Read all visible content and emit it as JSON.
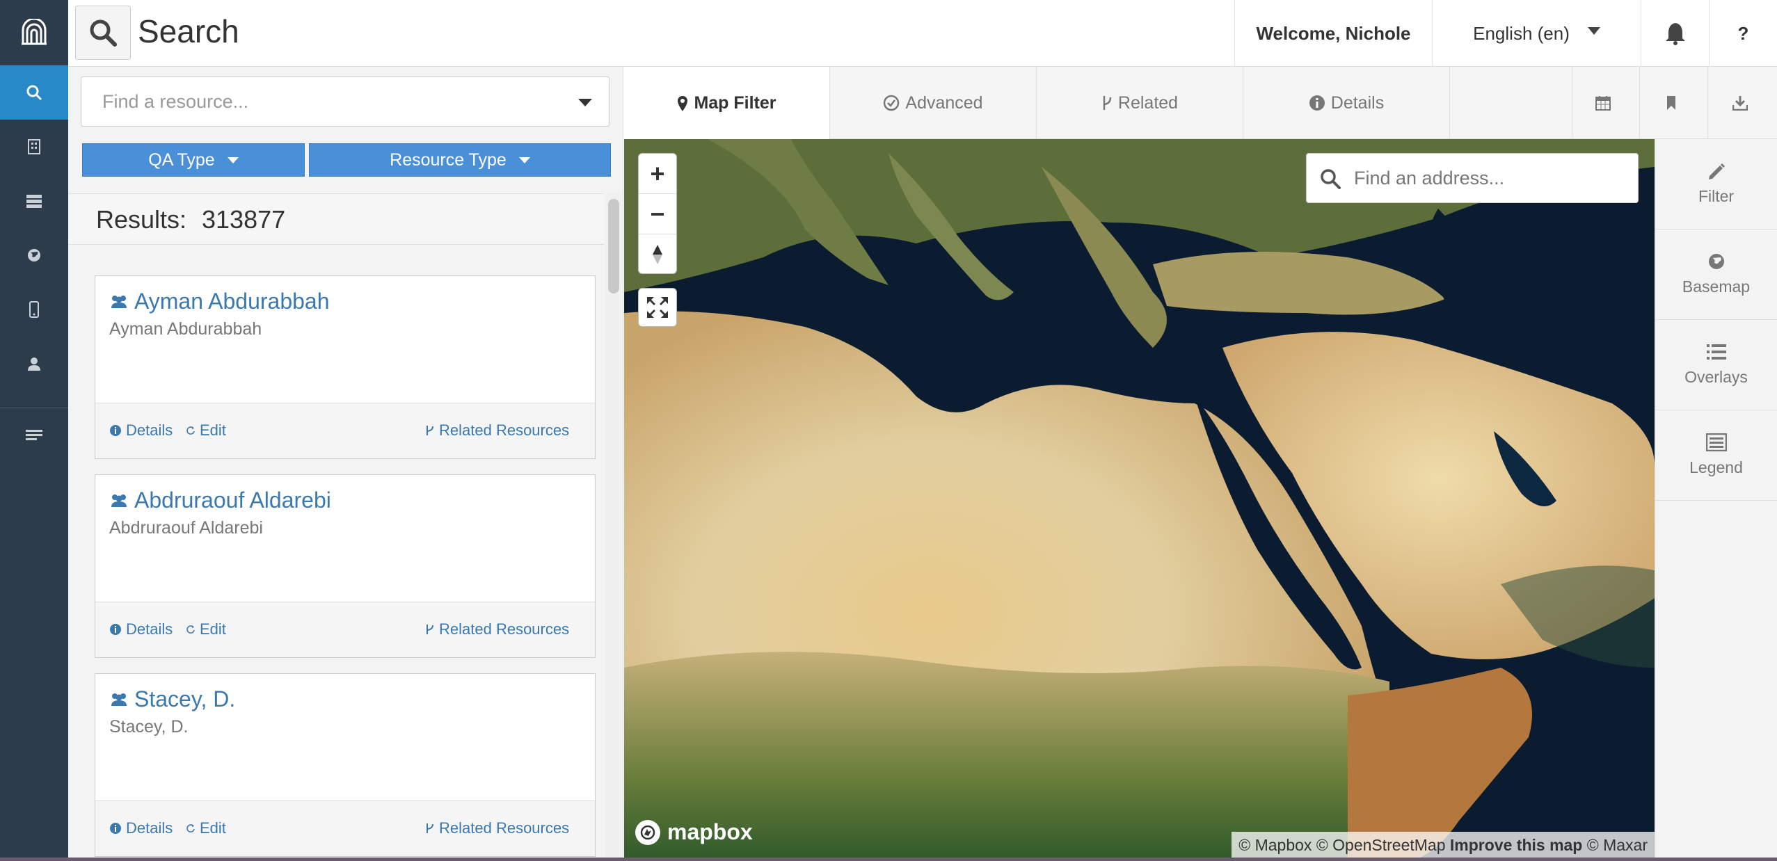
{
  "nav": {
    "items": [
      "search-icon",
      "building-icon",
      "server-icon",
      "globe-icon",
      "mobile-icon",
      "user-icon",
      "menu-icon"
    ],
    "accent": "#2889c8",
    "rail_color": "#2d3c4b"
  },
  "topbar": {
    "title": "Search",
    "welcome": "Welcome, Nichole",
    "language": "English (en)",
    "help": "?"
  },
  "search": {
    "placeholder": "Find a resource...",
    "filters": {
      "qa_type": "QA Type",
      "resource_type": "Resource Type"
    },
    "results_label": "Results:",
    "results_count": "313877"
  },
  "results": [
    {
      "name": "Ayman Abdurabbah",
      "subtitle": "Ayman Abdurabbah"
    },
    {
      "name": "Abdruraouf Aldarebi",
      "subtitle": "Abdruraouf Aldarebi"
    },
    {
      "name": "Stacey, D.",
      "subtitle": "Stacey, D."
    }
  ],
  "card_actions": {
    "details": "Details",
    "edit": "Edit",
    "related": "Related Resources"
  },
  "tabs": [
    {
      "label": "Map Filter",
      "icon": "map-marker-icon",
      "active": true
    },
    {
      "label": "Advanced",
      "icon": "check-circle-icon",
      "active": false
    },
    {
      "label": "Related",
      "icon": "branch-icon",
      "active": false
    },
    {
      "label": "Details",
      "icon": "info-icon",
      "active": false
    }
  ],
  "map": {
    "address_placeholder": "Find an address...",
    "zoom_in": "+",
    "zoom_out": "−",
    "brand": "mapbox",
    "attribution": {
      "mapbox": "© Mapbox",
      "osm": "© OpenStreetMap",
      "improve": "Improve this map",
      "maxar": "© Maxar"
    }
  },
  "tools": [
    {
      "label": "Filter",
      "icon": "pencil-icon"
    },
    {
      "label": "Basemap",
      "icon": "globe-icon"
    },
    {
      "label": "Overlays",
      "icon": "list-icon"
    },
    {
      "label": "Legend",
      "icon": "legend-icon"
    }
  ]
}
